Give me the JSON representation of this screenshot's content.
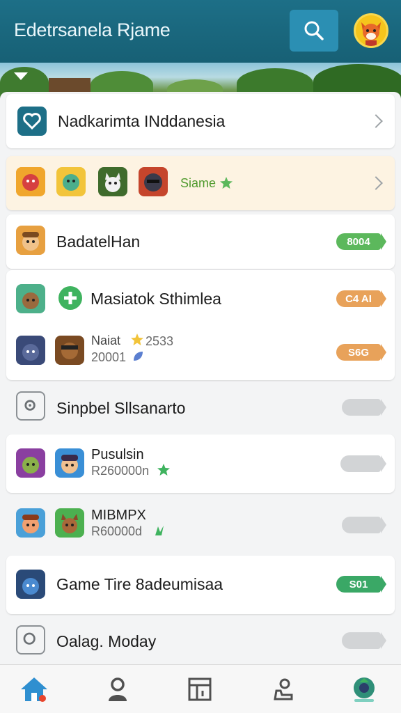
{
  "header": {
    "title": "Edetrsanela Rjame",
    "search_icon": "search-icon"
  },
  "featured": {
    "label": "Nadkarimta INddanesia",
    "icon": "heart-icon"
  },
  "team": {
    "label": "Siame",
    "badge_icon": "star-icon"
  },
  "items": [
    {
      "label": "BadatelHan",
      "badge": "8004",
      "badge_color": "#5cb85c"
    },
    {
      "label": "Masiatok Sthimlea",
      "badge": "C4 AI",
      "badge_color": "#e8a25a"
    },
    {
      "label": "Naiat",
      "stat": "2533",
      "sub": "20001",
      "badge": "S6G",
      "badge_color": "#e8a25a"
    },
    {
      "label": "Sinpbel Sllsanarto"
    },
    {
      "label": "Pusulsin",
      "sub": "R260000n"
    },
    {
      "label": "MIBMPX",
      "sub": "R60000d"
    },
    {
      "label": "Game Tire 8adeumisaa",
      "badge": "S01",
      "badge_color": "#3aa866"
    },
    {
      "label": "Oalag. Moday"
    }
  ],
  "colors": {
    "header": "#1d6f87",
    "search": "#2b8fb3",
    "accent_green": "#5cb85c",
    "accent_orange": "#e8a25a"
  },
  "nav": [
    {
      "name": "home",
      "icon": "home-icon",
      "active": true
    },
    {
      "name": "profile",
      "icon": "person-icon"
    },
    {
      "name": "board",
      "icon": "board-icon"
    },
    {
      "name": "achievements",
      "icon": "trophy-icon"
    },
    {
      "name": "globe",
      "icon": "globe-icon"
    }
  ]
}
